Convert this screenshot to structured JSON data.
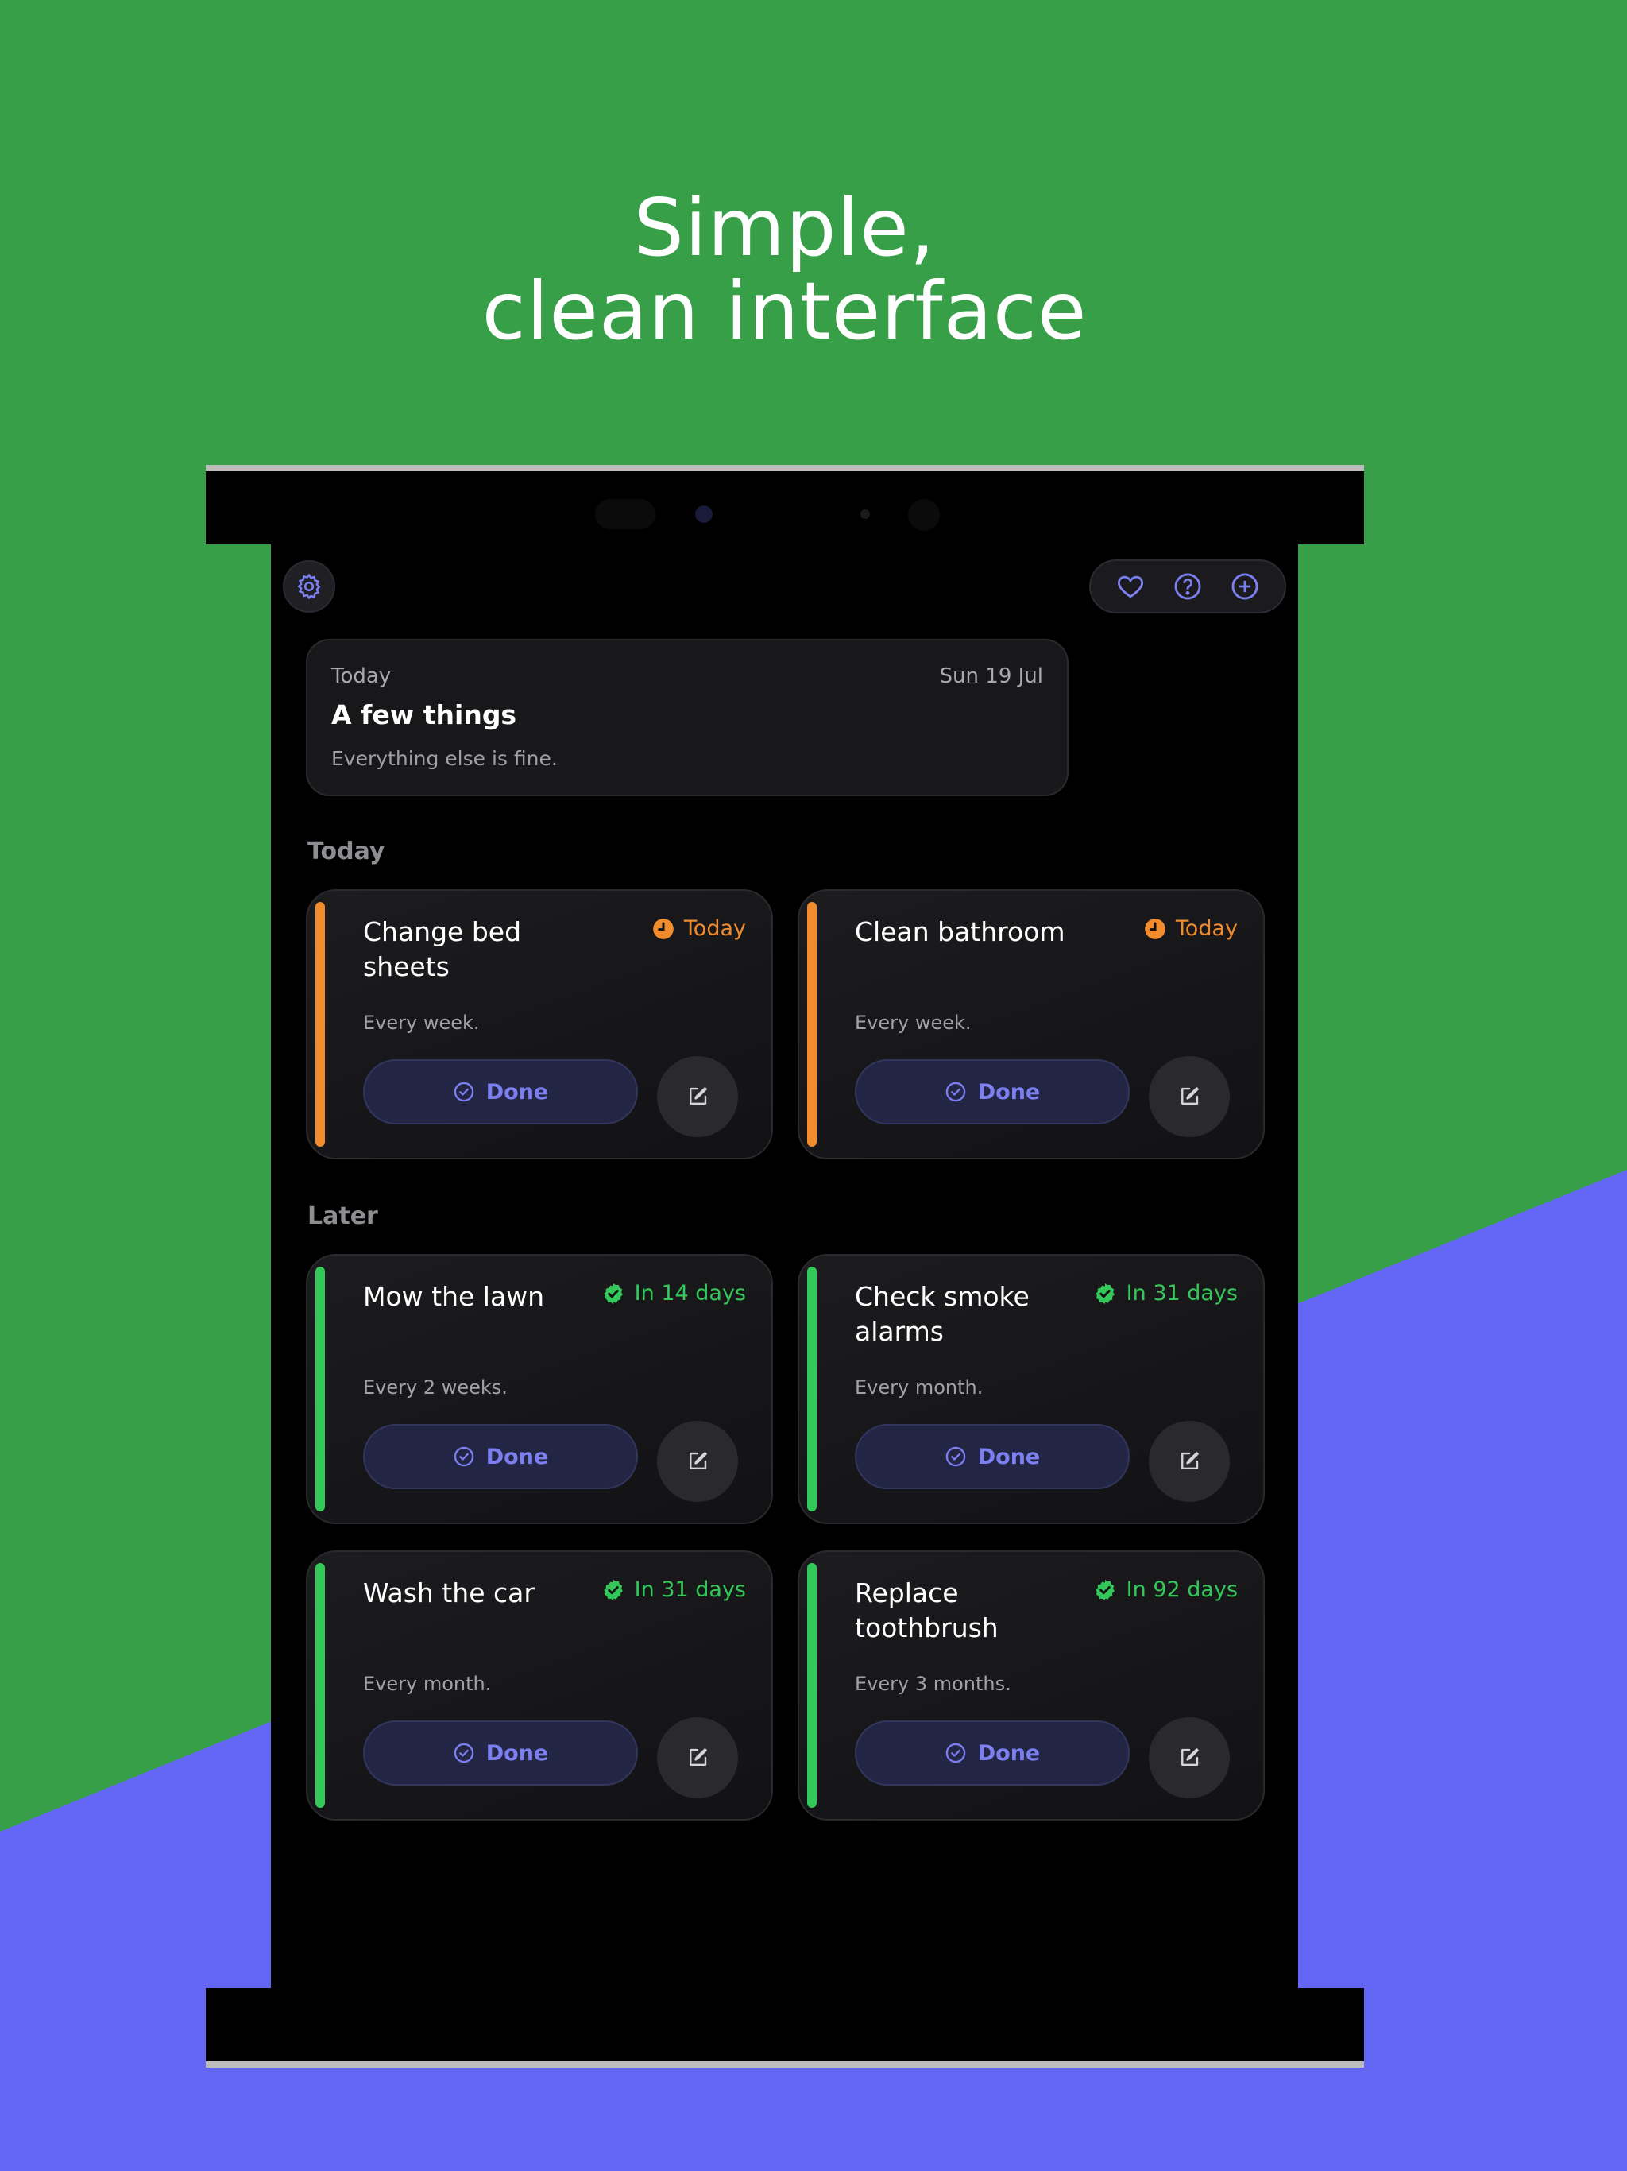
{
  "colors": {
    "green_bg": "#389f49",
    "blue_bg": "#6366f4",
    "accent": "#7c7ff0",
    "orange": "#f08b2e",
    "green": "#34c759"
  },
  "headline": {
    "line1": "Simple,",
    "line2": "clean interface"
  },
  "toolbar": {
    "settings_icon": "gear-icon",
    "favorite_icon": "heart-icon",
    "help_icon": "question-icon",
    "add_icon": "plus-circle-icon"
  },
  "summary": {
    "label": "Today",
    "date": "Sun 19 Jul",
    "title": "A few things",
    "subtitle": "Everything else is fine."
  },
  "sections": {
    "today": "Today",
    "later": "Later"
  },
  "tasks": [
    {
      "title": "Change bed sheets",
      "due": "Today",
      "status": "overdue",
      "frequency": "Every week.",
      "done_label": "Done"
    },
    {
      "title": "Clean bathroom",
      "due": "Today",
      "status": "overdue",
      "frequency": "Every week.",
      "done_label": "Done"
    },
    {
      "title": "Mow the lawn",
      "due": "In 14 days",
      "status": "ok",
      "frequency": "Every 2 weeks.",
      "done_label": "Done"
    },
    {
      "title": "Check smoke alarms",
      "due": "In 31 days",
      "status": "ok",
      "frequency": "Every month.",
      "done_label": "Done"
    },
    {
      "title": "Wash the car",
      "due": "In 31 days",
      "status": "ok",
      "frequency": "Every month.",
      "done_label": "Done"
    },
    {
      "title": "Replace toothbrush",
      "due": "In 92 days",
      "status": "ok",
      "frequency": "Every 3 months.",
      "done_label": "Done"
    }
  ]
}
